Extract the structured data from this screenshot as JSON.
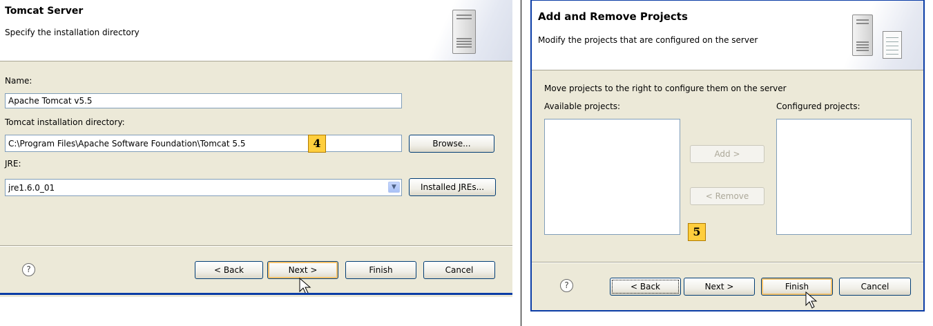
{
  "left": {
    "title": "Tomcat Server",
    "subtitle": "Specify the installation directory",
    "name_label": "Name:",
    "name_value": "Apache Tomcat v5.5",
    "dir_label": "Tomcat installation directory:",
    "dir_value": "C:\\Program Files\\Apache Software Foundation\\Tomcat 5.5",
    "browse_label": "Browse...",
    "jre_label": "JRE:",
    "jre_value": "jre1.6.0_01",
    "installed_jres_label": "Installed JREs...",
    "badge": "4",
    "help": "?",
    "back_label": "< Back",
    "next_label": "Next >",
    "finish_label": "Finish",
    "cancel_label": "Cancel"
  },
  "right": {
    "title": "Add and Remove Projects",
    "subtitle": "Modify the projects that are configured on the server",
    "instruction": "Move projects to the right to configure them on the server",
    "available_label": "Available projects:",
    "configured_label": "Configured projects:",
    "add_label": "Add >",
    "remove_label": "< Remove",
    "badge": "5",
    "help": "?",
    "back_label": "< Back",
    "next_label": "Next >",
    "finish_label": "Finish",
    "cancel_label": "Cancel"
  },
  "colors": {
    "dialog_bg": "#ece9d8",
    "input_border": "#7f9db9",
    "button_border": "#003c74",
    "default_button_glow": "#f6c36b",
    "badge_fill": "#ffce3d",
    "frame_blue": "#0a3ca6"
  },
  "icons": [
    "server-icon",
    "server-config-icon",
    "help-icon",
    "dropdown-arrow-icon",
    "mouse-cursor-icon"
  ]
}
